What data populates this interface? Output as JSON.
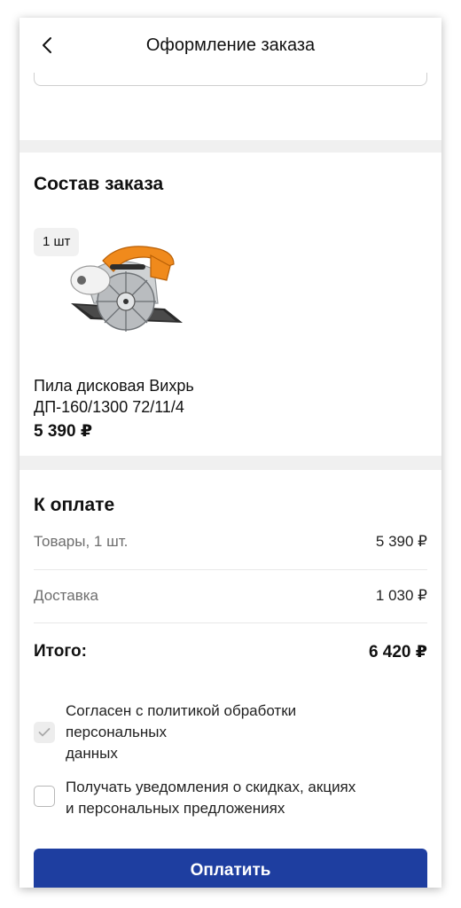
{
  "header": {
    "title": "Оформление заказа",
    "back_icon": "chevron-left-icon"
  },
  "order": {
    "title": "Состав заказа",
    "item": {
      "quantity": "1 шт",
      "name_line1": "Пила дисковая Вихрь",
      "name_line2": "ДП-160/1300 72/11/4",
      "price": "5 390 ₽",
      "image_icon": "circular-saw-image"
    }
  },
  "payment": {
    "title": "К оплате",
    "rows": [
      {
        "label": "Товары, 1 шт.",
        "value": "5 390 ₽"
      },
      {
        "label": "Доставка",
        "value": "1 030 ₽"
      }
    ],
    "total": {
      "label": "Итого:",
      "value": "6 420 ₽"
    },
    "consents": [
      {
        "lines": [
          "Согласен с политикой обработки",
          "персональных",
          "данных"
        ],
        "checked": true
      },
      {
        "lines": [
          "Получать уведомления о скидках, акциях",
          "и персональных предложениях"
        ],
        "checked": false
      }
    ],
    "pay_button": "Оплатить"
  },
  "colors": {
    "accent": "#1e3ea0",
    "page_bg": "#f0f0f0",
    "card_bg": "#ffffff"
  }
}
